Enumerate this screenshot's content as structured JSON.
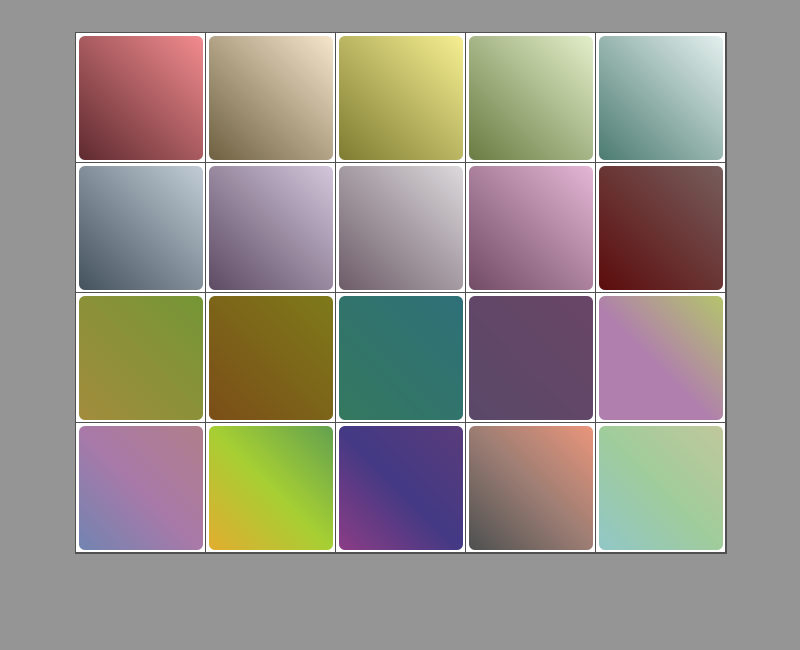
{
  "gradients": [
    {
      "from": "#5e2a2f",
      "to": "#f28c8f"
    },
    {
      "from": "#6e6041",
      "to": "#f6e6cc"
    },
    {
      "from": "#7f7c32",
      "to": "#f6ef92"
    },
    {
      "from": "#6a7c43",
      "to": "#e3efca"
    },
    {
      "from": "#4c7b72",
      "to": "#e4f0ee"
    },
    {
      "from": "#44525d",
      "to": "#c1ccd6"
    },
    {
      "from": "#5d4b63",
      "to": "#d3c7dc"
    },
    {
      "from": "#6d5c68",
      "to": "#dcd9dc"
    },
    {
      "from": "#724b65",
      "to": "#e3b7d5"
    },
    {
      "from": "#5c0c0c",
      "to": "#765e5c"
    },
    {
      "from": "#a28c3c",
      "to": "#749636"
    },
    {
      "from": "#7b4e18",
      "to": "#7e7a1a"
    },
    {
      "from": "#34785f",
      "to": "#2f7079"
    },
    {
      "from": "#5a4868",
      "to": "#694667"
    },
    {
      "from": "#b07fad",
      "to": "#b07fad",
      "third": "#b4c46c"
    },
    {
      "from": "#7284b1",
      "to": "#b07f8a",
      "mid": "#a979a8"
    },
    {
      "from": "#e2ad30",
      "to": "#63a14f",
      "mid": "#a6cf33"
    },
    {
      "from": "#8b3d85",
      "to": "#5a3c7a",
      "mid": "#433984"
    },
    {
      "from": "#4d5050",
      "to": "#ea967b",
      "mid": "#9c7d73"
    },
    {
      "from": "#91c7c7",
      "to": "#c0c89c",
      "mid": "#a0cc9b"
    }
  ]
}
